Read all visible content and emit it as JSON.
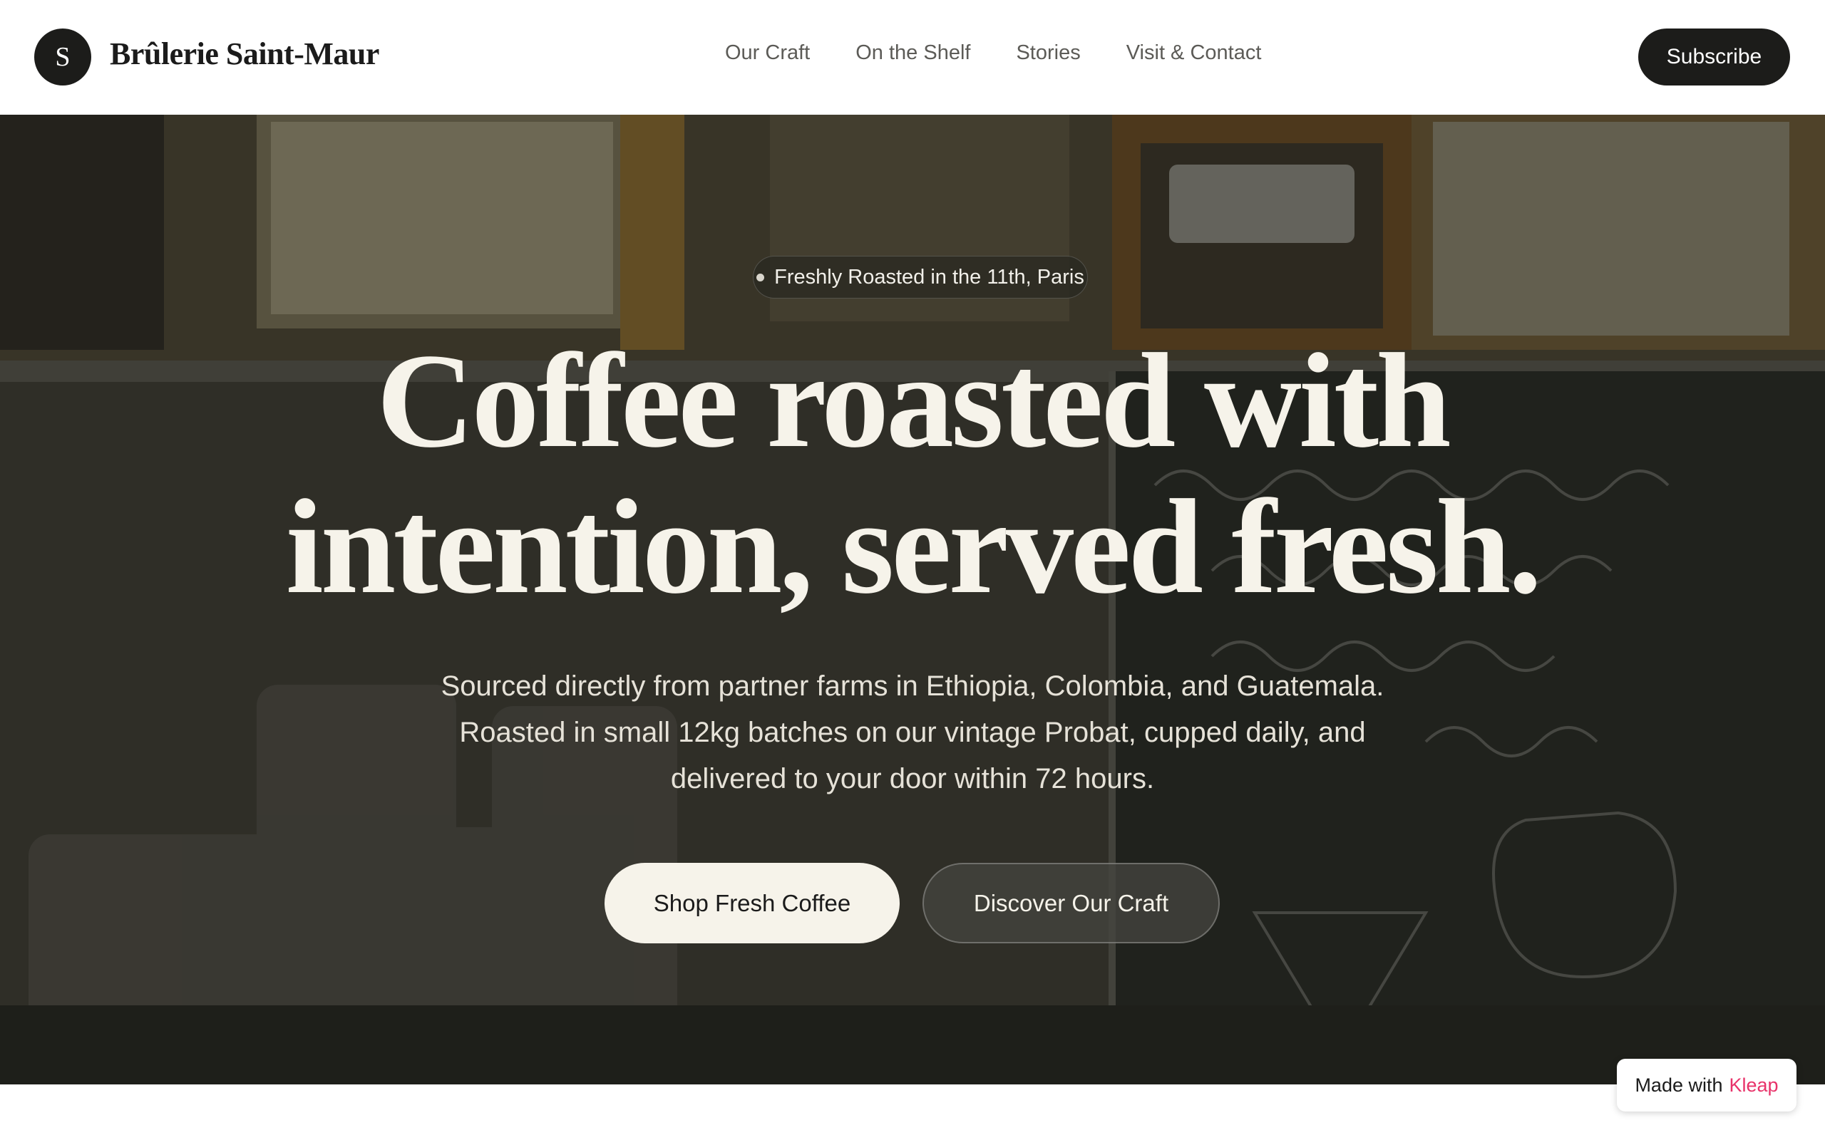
{
  "header": {
    "logo_letter": "S",
    "brand_name": "Brûlerie Saint-Maur",
    "nav": [
      {
        "label": "Our Craft"
      },
      {
        "label": "On the Shelf"
      },
      {
        "label": "Stories"
      },
      {
        "label": "Visit & Contact"
      }
    ],
    "subscribe_label": "Subscribe"
  },
  "hero": {
    "badge_text": "Freshly Roasted in the 11th, Paris",
    "title_line1": "Coffee roasted with",
    "title_line2": "intention, served fresh.",
    "subtitle": "Sourced directly from partner farms in Ethiopia, Colombia, and Guatemala. Roasted in small 12kg batches on our vintage Probat, cupped daily, and delivered to your door within 72 hours.",
    "primary_cta": "Shop Fresh Coffee",
    "secondary_cta": "Discover Our Craft",
    "background_image": "cafe-interior-photo"
  },
  "footer_badge": {
    "prefix": "Made with",
    "brand": "Kleap"
  },
  "colors": {
    "dark": "#1c1c1a",
    "cream": "#f6f3ea",
    "nav_text": "#5c5b57",
    "kleap_accent": "#e8336a"
  }
}
